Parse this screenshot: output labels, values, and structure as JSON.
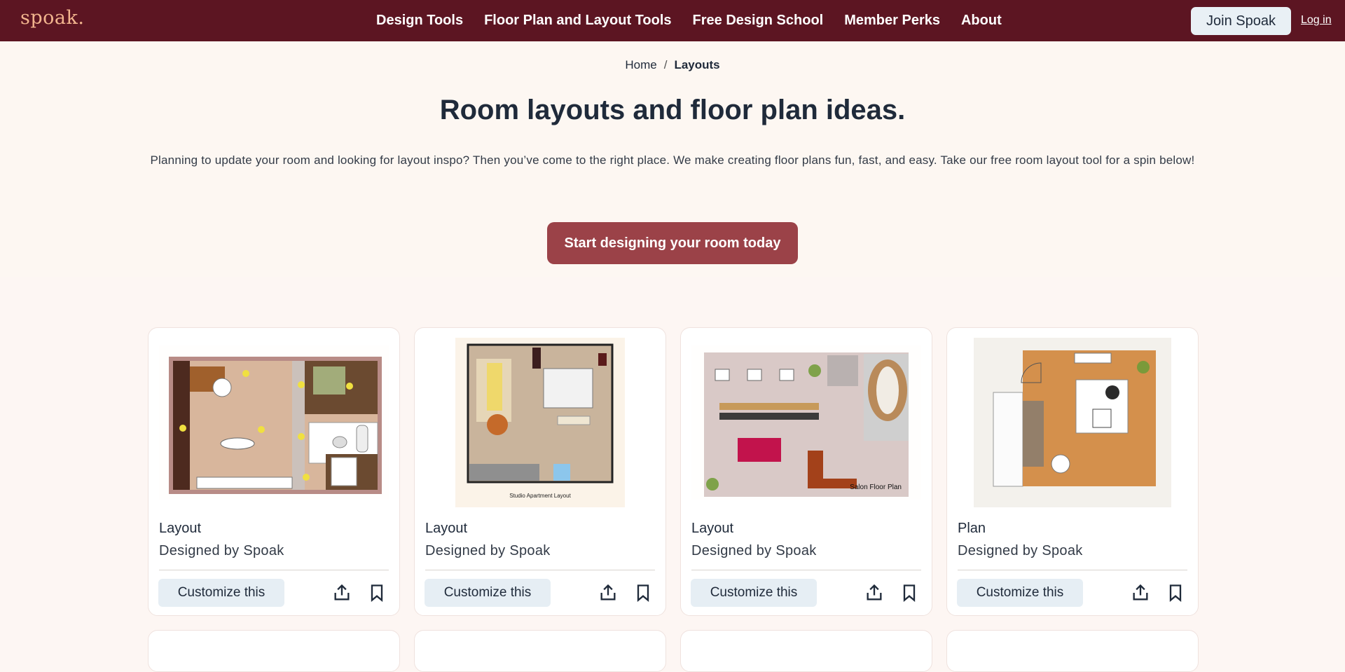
{
  "header": {
    "logo": "spoak.",
    "nav": [
      "Design Tools",
      "Floor Plan and Layout Tools",
      "Free Design School",
      "Member Perks",
      "About"
    ],
    "join_label": "Join Spoak",
    "login_label": "Log in"
  },
  "breadcrumb": {
    "home": "Home",
    "separator": "/",
    "current": "Layouts"
  },
  "hero": {
    "title": "Room layouts and floor plan ideas.",
    "intro": "Planning to update your room and looking for layout inspo? Then you’ve come to the right place. We make creating floor plans fun, fast, and easy. Take our free room layout tool for a spin below!",
    "cta_label": "Start designing your room today"
  },
  "cards": [
    {
      "title": "Layout",
      "designer": "Designed by Spoak",
      "customize_label": "Customize this",
      "thumb_caption": ""
    },
    {
      "title": "Layout",
      "designer": "Designed by Spoak",
      "customize_label": "Customize this",
      "thumb_caption": "Studio Apartment Layout"
    },
    {
      "title": "Layout",
      "designer": "Designed by Spoak",
      "customize_label": "Customize this",
      "thumb_caption": "Salon Floor Plan"
    },
    {
      "title": "Plan",
      "designer": "Designed by Spoak",
      "customize_label": "Customize this",
      "thumb_caption": ""
    }
  ],
  "colors": {
    "topbar": "#5c1522",
    "logo": "#f2b58e",
    "cta": "#9b4248",
    "customize_bg": "#e6eef4",
    "page_bg": "#fdf6f3"
  },
  "icons": {
    "share": "share-icon",
    "bookmark": "bookmark-icon"
  }
}
